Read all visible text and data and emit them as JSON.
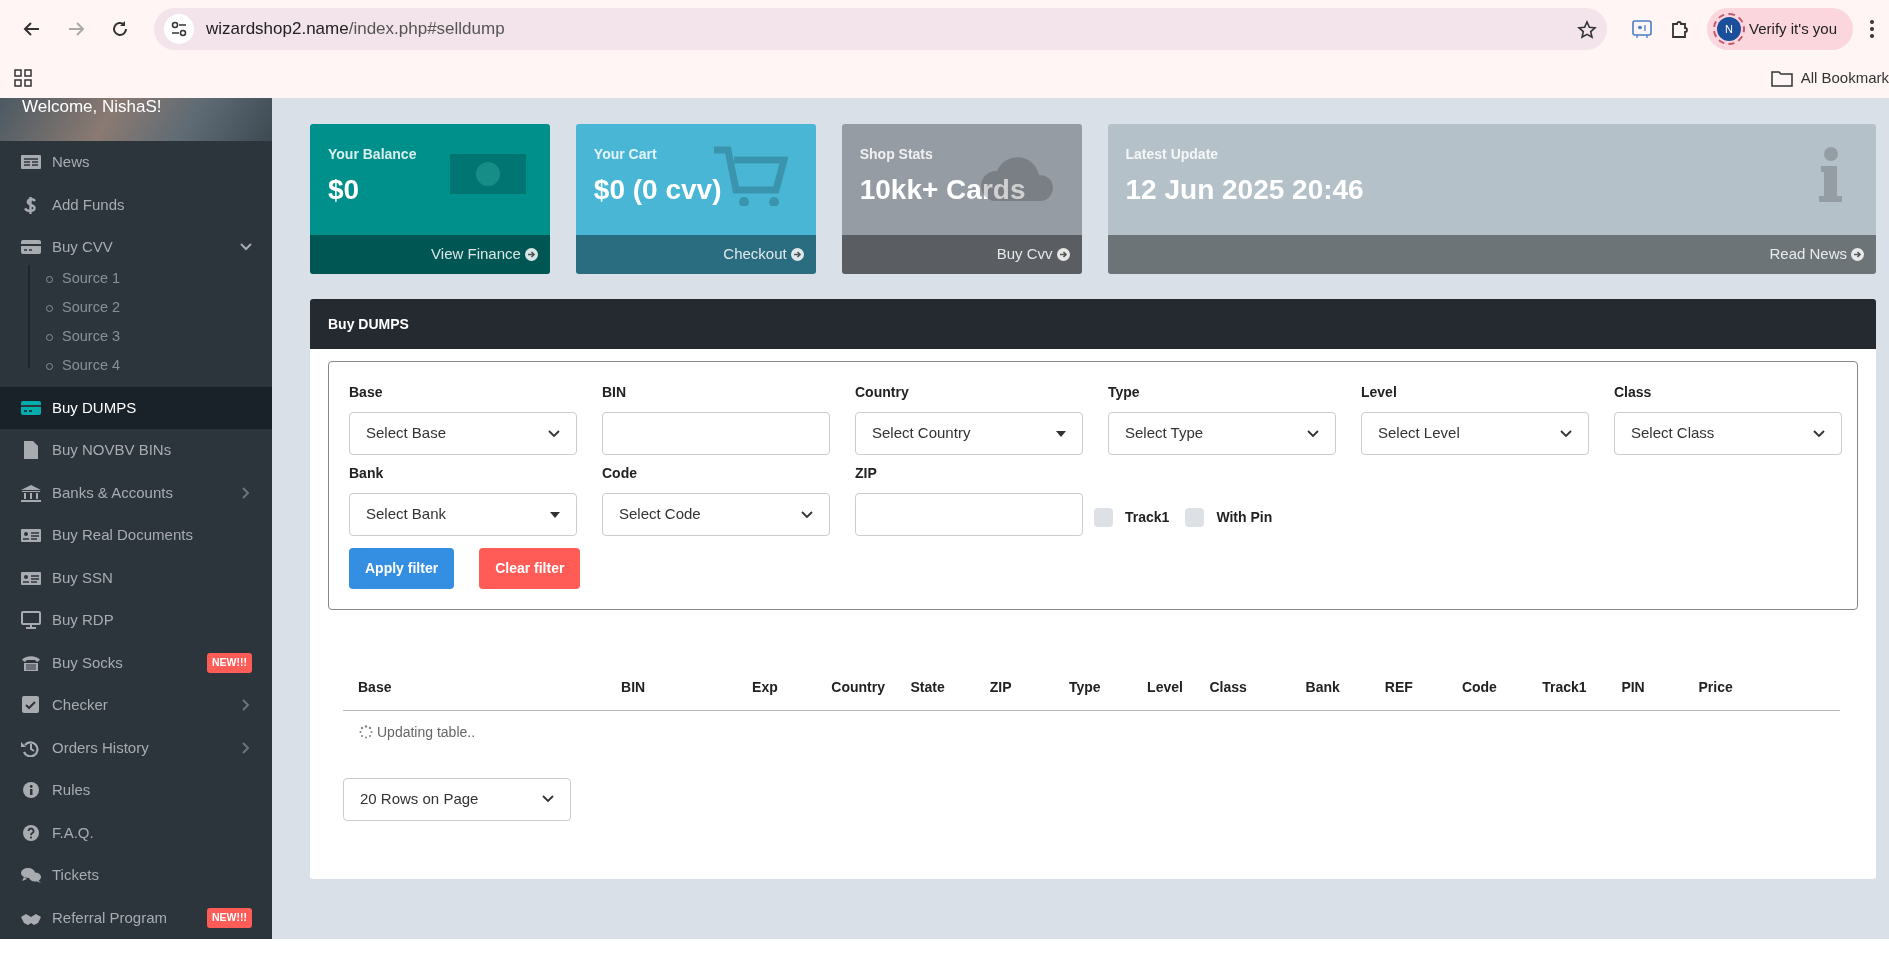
{
  "browser": {
    "url_host": "wizardshop2.name",
    "url_path": "/index.php#selldump",
    "forward_disabled": true,
    "profile_initial": "N",
    "profile_label": "Verify it's you",
    "bookmarks_label": "All Bookmark"
  },
  "sidebar": {
    "welcome": "Welcome, NishaS!",
    "items": [
      {
        "label": "News",
        "selected": false
      },
      {
        "label": "Add Funds",
        "selected": false
      },
      {
        "label": "Buy CVV",
        "selected": false,
        "expanded": true,
        "children": [
          {
            "label": "Source 1"
          },
          {
            "label": "Source 2"
          },
          {
            "label": "Source 3"
          },
          {
            "label": "Source 4"
          }
        ]
      },
      {
        "label": "Buy DUMPS",
        "selected": true
      },
      {
        "label": "Buy NOVBV BINs",
        "selected": false
      },
      {
        "label": "Banks & Accounts",
        "selected": false,
        "expanded": false
      },
      {
        "label": "Buy Real Documents",
        "selected": false
      },
      {
        "label": "Buy SSN",
        "selected": false
      },
      {
        "label": "Buy RDP",
        "selected": false
      },
      {
        "label": "Buy Socks",
        "selected": false,
        "badge": "NEW!!!"
      },
      {
        "label": "Checker",
        "selected": false,
        "expanded": false
      },
      {
        "label": "Orders History",
        "selected": false,
        "expanded": false
      },
      {
        "label": "Rules",
        "selected": false
      },
      {
        "label": "F.A.Q.",
        "selected": false
      },
      {
        "label": "Tickets",
        "selected": false
      },
      {
        "label": "Referral Program",
        "selected": false,
        "badge": "NEW!!!"
      }
    ]
  },
  "stat_cards": [
    {
      "title": "Your Balance",
      "value": "$0",
      "link": "View Finance",
      "color": "#00908b"
    },
    {
      "title": "Your Cart",
      "value": "$0 (0 cvv)",
      "link": "Checkout",
      "color": "#49b6d6"
    },
    {
      "title": "Shop Stats",
      "value": "10kk+ Cards",
      "link": "Buy Cvv",
      "color": "#969ca3"
    },
    {
      "title": "Latest Update",
      "value": "12 Jun 2025 20:46",
      "link": "Read News",
      "color": "#b5c1c8"
    }
  ],
  "panel": {
    "title": "Buy DUMPS",
    "filters": [
      {
        "kind": "select",
        "label": "Base",
        "placeholder": "Select Base"
      },
      {
        "kind": "input",
        "label": "BIN"
      },
      {
        "kind": "combo",
        "label": "Country",
        "placeholder": "Select Country"
      },
      {
        "kind": "select",
        "label": "Type",
        "placeholder": "Select Type"
      },
      {
        "kind": "select",
        "label": "Level",
        "placeholder": "Select Level"
      },
      {
        "kind": "select",
        "label": "Class",
        "placeholder": "Select Class"
      },
      {
        "kind": "combo",
        "label": "Bank",
        "placeholder": "Select Bank"
      },
      {
        "kind": "select",
        "label": "Code",
        "placeholder": "Select Code"
      },
      {
        "kind": "input",
        "label": "ZIP"
      }
    ],
    "checkboxes": [
      {
        "label": "Track1",
        "checked": false
      },
      {
        "label": "With Pin",
        "checked": false
      }
    ],
    "buttons": [
      {
        "label": "Apply filter",
        "kind": "primary"
      },
      {
        "label": "Clear filter",
        "kind": "danger"
      }
    ],
    "table": {
      "columns": [
        "Base",
        "BIN",
        "Exp",
        "Country",
        "State",
        "ZIP",
        "Type",
        "Level",
        "Class",
        "Bank",
        "REF",
        "Code",
        "Track1",
        "PIN",
        "Price"
      ],
      "status": "Updating table.."
    },
    "page_size": "20 Rows on Page"
  }
}
